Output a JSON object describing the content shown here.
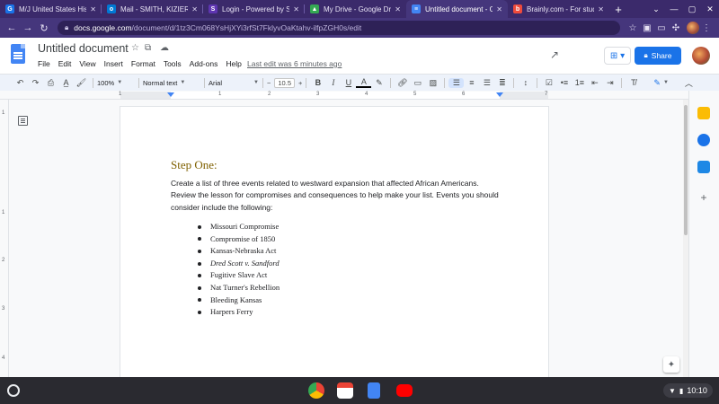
{
  "browser": {
    "tabs": [
      {
        "title": "M/J United States Hist",
        "favicon": "classroom-icon",
        "color": "#1a73e8",
        "active": false
      },
      {
        "title": "Mail - SMITH, KIZIER (",
        "favicon": "outlook-icon",
        "color": "#0078d4",
        "active": false
      },
      {
        "title": "Login - Powered by Sky",
        "favicon": "sky-icon",
        "color": "#5e35b1",
        "active": false
      },
      {
        "title": "My Drive - Google Drive",
        "favicon": "drive-icon",
        "color": "#34a853",
        "active": false
      },
      {
        "title": "Untitled document - Go",
        "favicon": "docs-icon",
        "color": "#4285f4",
        "active": true
      },
      {
        "title": "Brainly.com - For stude",
        "favicon": "brainly-icon",
        "color": "#ef4b3c",
        "active": false
      }
    ],
    "new_tab_label": "+",
    "url_host": "docs.google.com",
    "url_path": "/document/d/1tz3Cm068YsHjXYi3rfSt7FklyvOaKtahv-ilfpZGH0s/edit"
  },
  "docs": {
    "title": "Untitled document",
    "menu": [
      "File",
      "Edit",
      "View",
      "Insert",
      "Format",
      "Tools",
      "Add-ons",
      "Help"
    ],
    "last_edit": "Last edit was 6 minutes ago",
    "share_label": "Share",
    "toolbar": {
      "zoom": "100%",
      "style": "Normal text",
      "font": "Arial",
      "font_size": "10.5"
    },
    "ruler_numbers": [
      "1",
      "1",
      "2",
      "3",
      "4",
      "5",
      "6",
      "7"
    ],
    "vruler_numbers": [
      "1",
      "1",
      "2",
      "3",
      "4"
    ],
    "colors": {
      "accent": "#1a73e8",
      "heading": "#7f6000"
    }
  },
  "document": {
    "heading": "Step One:",
    "paragraph": "Create a list of three events related to westward expansion that affected African Americans. Review the lesson for compromises and consequences to help make your list. Events you should consider include the following:",
    "list": [
      {
        "text": "Missouri Compromise",
        "italic": false
      },
      {
        "text": "Compromise of 1850",
        "italic": false
      },
      {
        "text": "Kansas-Nebraska Act",
        "italic": false
      },
      {
        "text": "Dred Scott v. Sandford",
        "italic": true
      },
      {
        "text": "Fugitive Slave Act",
        "italic": false
      },
      {
        "text": "Nat Turner's Rebellion",
        "italic": false
      },
      {
        "text": "Bleeding Kansas",
        "italic": false
      },
      {
        "text": "Harpers Ferry",
        "italic": false
      }
    ]
  },
  "shelf": {
    "apps": [
      "chrome-icon",
      "gmail-icon",
      "docs-icon",
      "youtube-icon"
    ],
    "time": "10:10"
  }
}
